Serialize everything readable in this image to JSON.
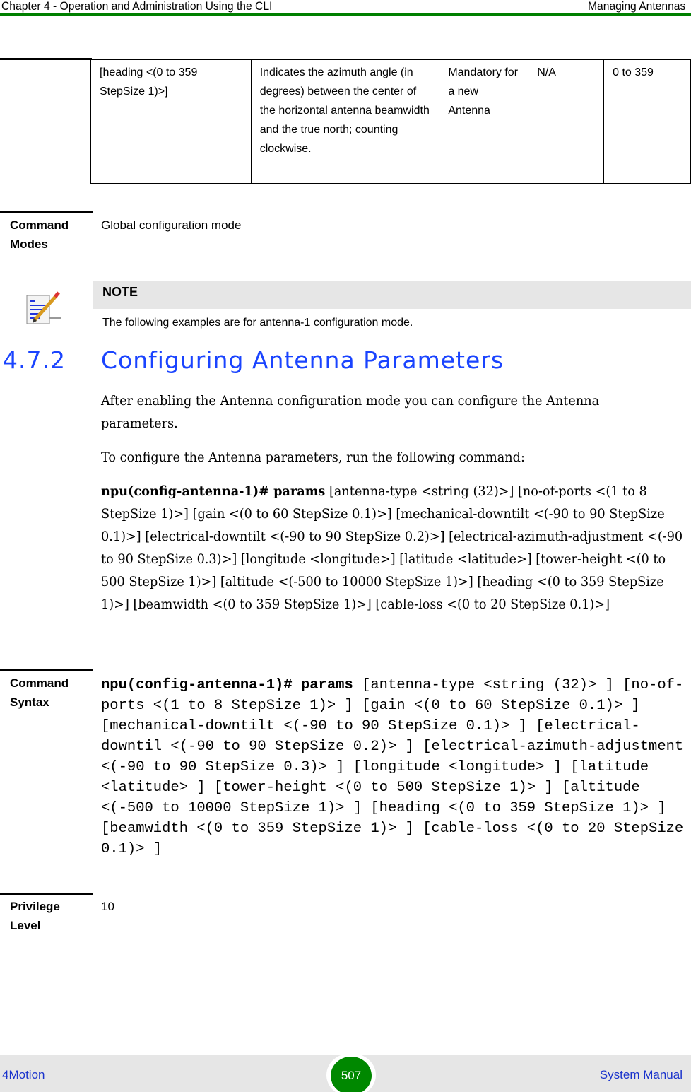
{
  "header": {
    "chapter": "Chapter 4 - Operation and Administration Using the CLI",
    "section": "Managing Antennas",
    "accent_color": "#008000"
  },
  "param_table": {
    "rows": [
      {
        "parameter": "[heading  <(0 to 359 StepSize 1)>]",
        "description": "Indicates the azimuth angle (in degrees) between the center of the horizontal antenna beamwidth and the true north; counting clockwise.",
        "presence": "Mandatory for a new Antenna",
        "default": "N/A",
        "possible_values": "0 to 359"
      }
    ]
  },
  "command_modes": {
    "label": "Command Modes",
    "value": "Global configuration mode"
  },
  "note": {
    "icon": "note-pencil-icon",
    "title": "NOTE",
    "text": "The following examples are for antenna-1 configuration mode."
  },
  "section": {
    "number": "4.7.2",
    "title": "Configuring Antenna Parameters",
    "color": "#1a44ff"
  },
  "body": {
    "para1": "After enabling the Antenna configuration mode you can configure the Antenna parameters.",
    "para2": "To configure the Antenna parameters, run the following command:",
    "command_bold": "npu(config-antenna-1)# params",
    "command_rest": " [antenna-type <string (32)>] [no-of-ports <(1 to 8 StepSize 1)>] [gain <(0 to 60 StepSize 0.1)>] [mechanical-downtilt <(-90 to 90 StepSize 0.1)>] [electrical-downtilt <(-90 to 90 StepSize 0.2)>] [electrical-azimuth-adjustment <(-90 to 90 StepSize 0.3)>] [longitude <longitude>] [latitude <latitude>] [tower-height <(0 to 500 StepSize 1)>] [altitude <(-500 to 10000 StepSize 1)>] [heading <(0 to 359 StepSize 1)>] [beamwidth <(0 to 359 StepSize 1)>] [cable-loss <(0 to 20 StepSize 0.1)>]"
  },
  "command_syntax": {
    "label": "Command Syntax",
    "bold": "npu(config-antenna-1)# params",
    "rest": " [antenna-type <string (32)> ] [no-of-ports <(1 to 8 StepSize 1)> ] [gain <(0 to 60 StepSize 0.1)> ] [mechanical-downtilt <(-90 to 90 StepSize 0.1)> ] [electrical-downtil <(-90 to 90 StepSize 0.2)> ] [electrical-azimuth-adjustment <(-90 to 90 StepSize 0.3)> ] [longitude <longitude> ] [latitude <latitude> ] [tower-height <(0 to 500 StepSize 1)> ] [altitude <(-500 to 10000 StepSize 1)> ] [heading <(0 to 359 StepSize 1)> ] [beamwidth <(0 to 359 StepSize 1)> ] [cable-loss <(0 to 20 StepSize 0.1)> ]"
  },
  "privilege_level": {
    "label": "Privilege Level",
    "value": "10"
  },
  "footer": {
    "left": "4Motion",
    "page": "507",
    "right": "System Manual",
    "link_color": "#1a33cc"
  }
}
